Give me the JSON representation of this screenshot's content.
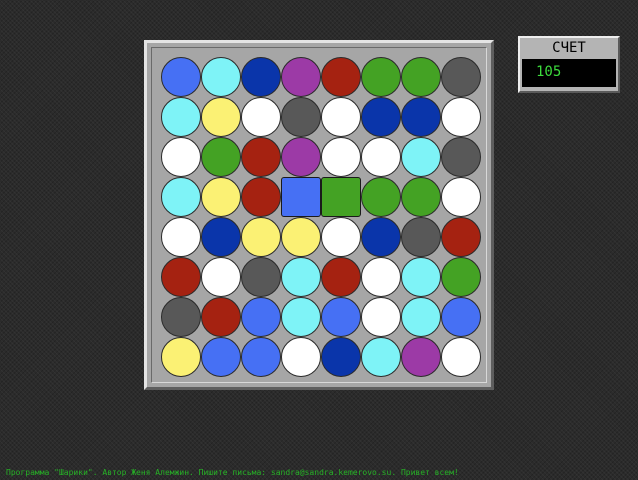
{
  "palette": {
    "W": "#ffffff",
    "C": "#7ef3f7",
    "Y": "#fbf174",
    "R": "#a52211",
    "G": "#44a224",
    "B": "#4670f4",
    "N": "#0a35aa",
    "P": "#9c3aa6",
    "D": "#585858"
  },
  "board": {
    "rows": [
      [
        "B",
        "C",
        "N",
        "P",
        "R",
        "G",
        "G",
        "D"
      ],
      [
        "C",
        "Y",
        "W",
        "D",
        "W",
        "N",
        "N",
        "W"
      ],
      [
        "W",
        "G",
        "R",
        "P",
        "W",
        "W",
        "C",
        "D"
      ],
      [
        "C",
        "Y",
        "R",
        "B",
        "G",
        "G",
        "G",
        "W"
      ],
      [
        "W",
        "N",
        "Y",
        "Y",
        "W",
        "N",
        "D",
        "R"
      ],
      [
        "R",
        "W",
        "D",
        "C",
        "R",
        "W",
        "C",
        "G"
      ],
      [
        "D",
        "R",
        "B",
        "C",
        "B",
        "W",
        "C",
        "B"
      ],
      [
        "Y",
        "B",
        "B",
        "W",
        "N",
        "C",
        "P",
        "W"
      ]
    ],
    "selected": [
      [
        3,
        3
      ],
      [
        3,
        4
      ]
    ]
  },
  "score": {
    "title": "СЧЕТ",
    "value": "105"
  },
  "footer": {
    "text": "Программа \"Шарики\". Автор Женя Алемжин. Пишите письма: sandra@sandra.kemerovo.su. Привет всем!"
  }
}
